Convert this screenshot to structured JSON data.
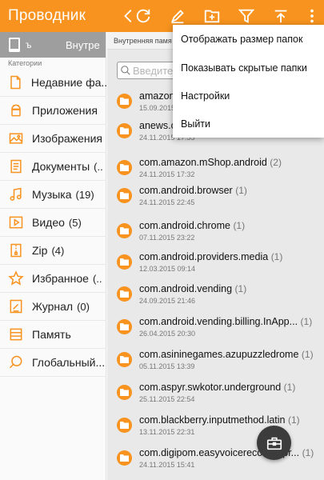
{
  "app_title": "Проводник",
  "colors": {
    "accent": "#f7931e",
    "tabstrip": "#9e9e9e",
    "fab": "#3c3c3c"
  },
  "toolbar": {
    "icons": [
      "back-icon",
      "refresh-icon",
      "edit-icon",
      "new-folder-icon",
      "filter-icon",
      "sort-icon",
      "more-vertical-icon"
    ]
  },
  "sidebar": {
    "tabs": {
      "text1": "ъ",
      "text2": "Внутре"
    },
    "category_header": "Категории",
    "items": [
      {
        "label": "Недавние фа...",
        "count": "",
        "icon": "recent-file-icon"
      },
      {
        "label": "Приложения",
        "count": "",
        "icon": "android-icon"
      },
      {
        "label": "Изображения",
        "count": "",
        "icon": "image-icon"
      },
      {
        "label": "Документы",
        "count": "(..",
        "icon": "document-icon"
      },
      {
        "label": "Музыка",
        "count": "(19)",
        "icon": "music-icon"
      },
      {
        "label": "Видео",
        "count": "(5)",
        "icon": "video-icon"
      },
      {
        "label": "Zip",
        "count": "(4)",
        "icon": "zip-icon"
      },
      {
        "label": "Избранное",
        "count": "(..",
        "icon": "star-icon"
      },
      {
        "label": "Журнал",
        "count": "(0)",
        "icon": "journal-icon"
      },
      {
        "label": "Память",
        "count": "",
        "icon": "storage-icon"
      },
      {
        "label": "Глобальный...",
        "count": "",
        "icon": "global-search-icon"
      }
    ]
  },
  "main": {
    "path": "Внутренняя памя",
    "search_placeholder": "Введите",
    "files": [
      {
        "name": "amazon",
        "count": "",
        "date": "15.09.2015"
      },
      {
        "name": "anews.c",
        "count": "",
        "date": "24.11.2015 17:55"
      },
      {
        "name": "com.amazon.mShop.android",
        "count": "(2)",
        "date": "24.11.2015 17:32"
      },
      {
        "name": "com.android.browser",
        "count": "(1)",
        "date": "24.11.2015 22:45"
      },
      {
        "name": "com.android.chrome",
        "count": "(1)",
        "date": "07.11.2015 23:22"
      },
      {
        "name": "com.android.providers.media",
        "count": "(1)",
        "date": "12.03.2015 09:14"
      },
      {
        "name": "com.android.vending",
        "count": "(1)",
        "date": "24.09.2015 21:46"
      },
      {
        "name": "com.android.vending.billing.InApp...",
        "count": "(1)",
        "date": "26.04.2015 20:30"
      },
      {
        "name": "com.asininegames.azupuzzledrome",
        "count": "(1)",
        "date": "05.11.2015 13:39"
      },
      {
        "name": "com.aspyr.swkotor.underground",
        "count": "(1)",
        "date": "25.11.2015 22:54"
      },
      {
        "name": "com.blackberry.inputmethod.latin",
        "count": "(1)",
        "date": "13.11.2015 22:31"
      },
      {
        "name": "com.digipom.easyvoicerecorder.pr...",
        "count": "(1)",
        "date": "24.11.2015 15:41"
      }
    ]
  },
  "menu": {
    "items": [
      "Отображать размер папок",
      "Показывать скрытые папки",
      "Настройки",
      "Выйти"
    ]
  },
  "fab": {
    "icon": "toolbox-icon"
  }
}
